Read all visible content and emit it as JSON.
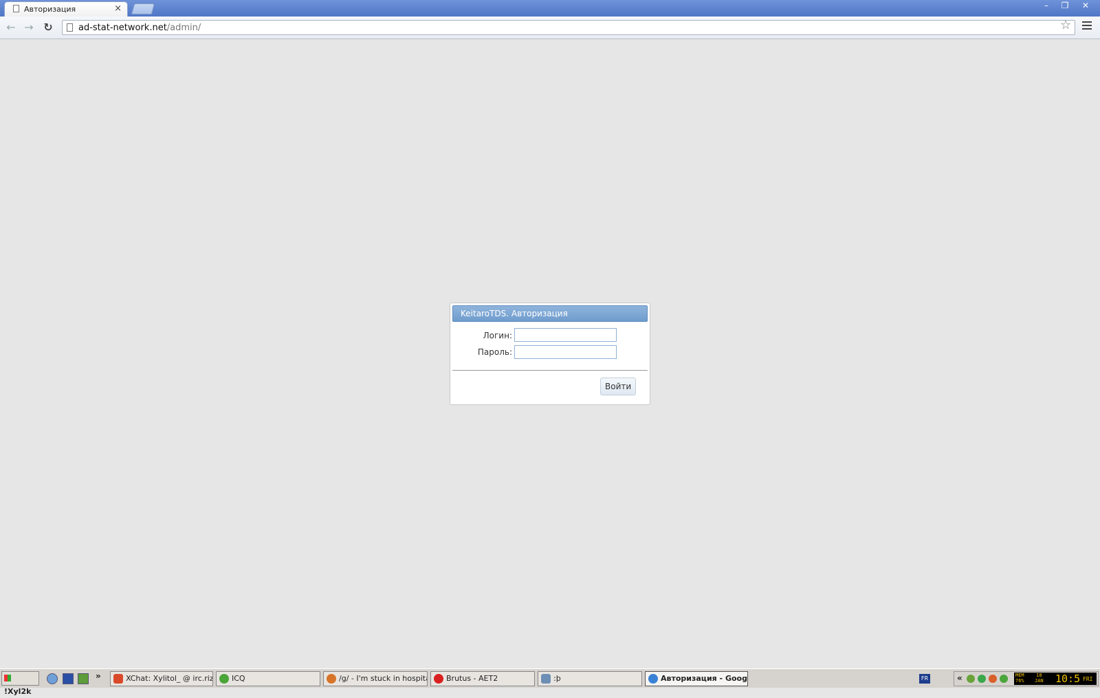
{
  "browser": {
    "tab_title": "Авторизация",
    "tab_close": "×",
    "url_host": "ad-stat-network.net",
    "url_path": "/admin/",
    "window_controls": {
      "minimize": "–",
      "maximize": "❐",
      "close": "✕"
    }
  },
  "login": {
    "header": "KeitaroTDS. Авторизация",
    "login_label": "Логин:",
    "password_label": "Пароль:",
    "login_value": "",
    "password_value": "",
    "submit_label": "Войти"
  },
  "taskbar": {
    "start_label": "!Xyl2k",
    "more": "»",
    "tasks": [
      {
        "label": "XChat: Xylitol_ @ irc.rizo...",
        "icon": "xchat-icon",
        "color": "#d94a2a"
      },
      {
        "label": "ICQ",
        "icon": "icq-icon",
        "color": "#4aa53a"
      },
      {
        "label": "/g/ - I'm stuck in hospital ...",
        "icon": "firefox-icon",
        "color": "#d8742a"
      },
      {
        "label": "Brutus - AET2",
        "icon": "error-icon",
        "color": "#d92020"
      },
      {
        "label": ":þ",
        "icon": "folder-icon",
        "color": "#6d8fb5"
      },
      {
        "label": "Авторизация - Googl...",
        "icon": "chrome-icon",
        "color": "#3a82d6"
      }
    ],
    "lang": "FR",
    "tray_chevron": "«",
    "mem": "MEM\n76%",
    "date": "18\nJAN",
    "time": "10:5",
    "day": "FRI"
  }
}
